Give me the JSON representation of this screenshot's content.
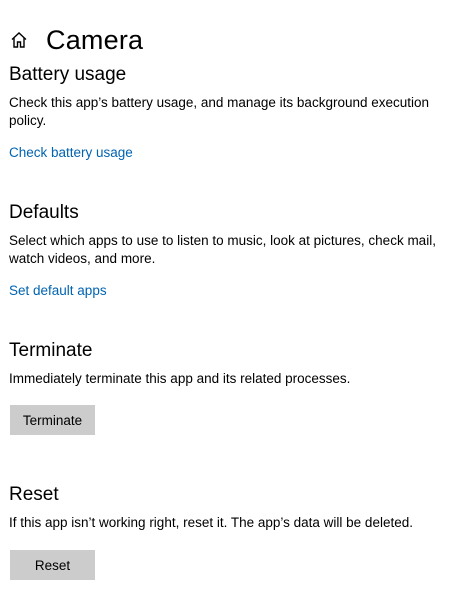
{
  "header": {
    "title": "Camera",
    "home_icon": "home-icon"
  },
  "battery": {
    "title": "Battery usage",
    "description": "Check this app’s battery usage, and manage its background execution policy.",
    "link": "Check battery usage"
  },
  "defaults": {
    "title": "Defaults",
    "description": "Select which apps to use to listen to music, look at pictures, check mail, watch videos, and more.",
    "link": "Set default apps"
  },
  "terminate": {
    "title": "Terminate",
    "description": "Immediately terminate this app and its related processes.",
    "button": "Terminate"
  },
  "reset": {
    "title": "Reset",
    "description": "If this app isn’t working right, reset it. The app’s data will be deleted.",
    "button": "Reset"
  },
  "colors": {
    "link": "#0063b1",
    "button_bg": "#cccccc",
    "background": "#ffffff"
  }
}
